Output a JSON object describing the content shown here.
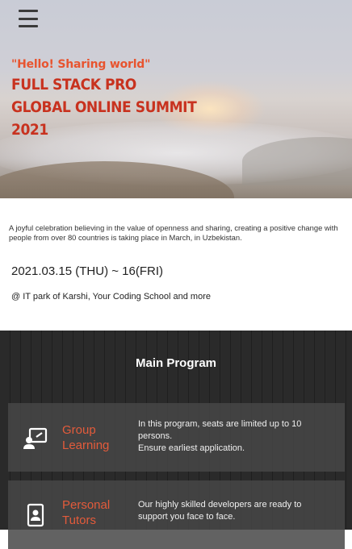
{
  "hero": {
    "tagline": "\"Hello! Sharing world\"",
    "title_lines": [
      "FULL STACK PRO",
      "GLOBAL ONLINE SUMMIT",
      "2021"
    ]
  },
  "intro": {
    "description": "A joyful celebration believing in the value of openness and sharing, creating a positive change with people from over 80 countries is taking place in March, in Uzbekistan.",
    "date": "2021.03.15 (THU) ~ 16(FRI)",
    "venue": "@ IT park of Karshi, Your Coding School and more"
  },
  "program": {
    "title": "Main Program",
    "items": [
      {
        "icon": "presenter-board-icon",
        "name_lines": [
          "Group",
          "Learning"
        ],
        "desc_lines": [
          "In this program, seats are limited up to 10",
          "persons.",
          "Ensure earliest application."
        ]
      },
      {
        "icon": "id-badge-icon",
        "name_lines": [
          "Personal",
          "Tutors"
        ],
        "desc_lines": [
          "Our highly skilled developers are ready to",
          "support you face to face."
        ]
      }
    ]
  },
  "colors": {
    "accent": "#e35b3b",
    "title_red": "#c8321f",
    "dark_bg": "#262626"
  }
}
